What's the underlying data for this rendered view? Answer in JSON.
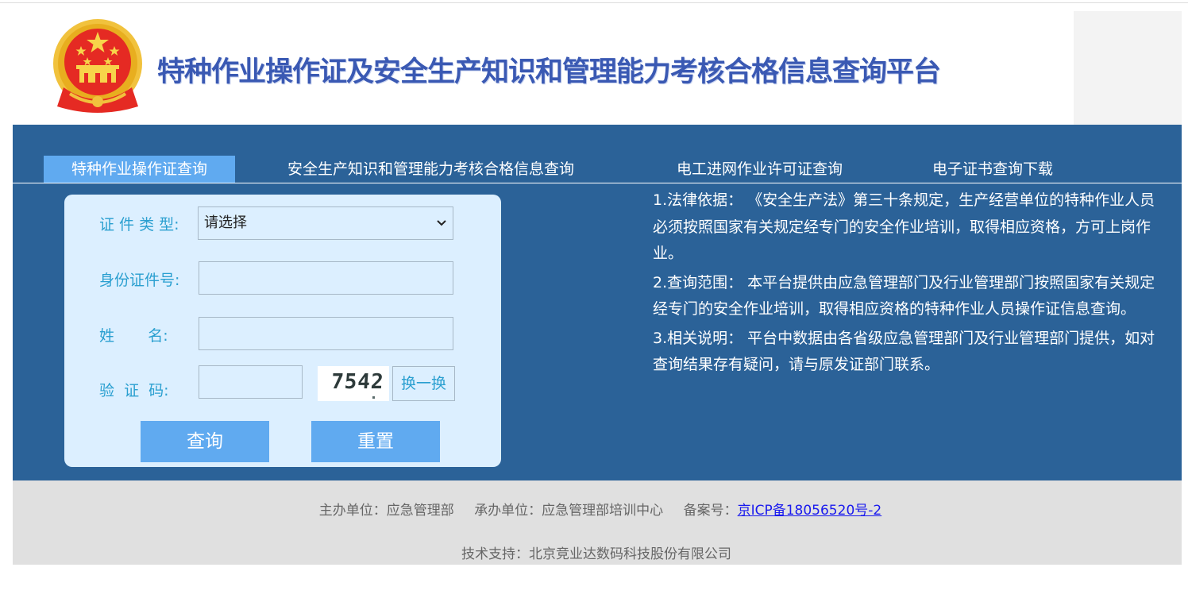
{
  "header": {
    "site_title": "特种作业操作证及安全生产知识和管理能力考核合格信息查询平台",
    "emblem_icon": "national-emblem-icon"
  },
  "tabs": [
    {
      "label": "特种作业操作证查询",
      "active": true
    },
    {
      "label": "安全生产知识和管理能力考核合格信息查询",
      "active": false
    },
    {
      "label": "电工进网作业许可证查询",
      "active": false
    },
    {
      "label": "电子证书查询下载",
      "active": false
    }
  ],
  "form": {
    "cert_type_label": "证 件 类 型:",
    "cert_type_value": "请选择",
    "id_label": "身份证件号:",
    "id_value": "",
    "name_label": "姓       名:",
    "name_value": "",
    "captcha_label": "验  证  码:",
    "captcha_value": "",
    "captcha_image_text": "7542",
    "refresh_label": "换一换",
    "query_label": "查询",
    "reset_label": "重置"
  },
  "notes": [
    "1.法律依据： 《安全生产法》第三十条规定，生产经营单位的特种作业人员必须按照国家有关规定经专门的安全作业培训，取得相应资格，方可上岗作业。",
    "2.查询范围： 本平台提供由应急管理部门及行业管理部门按照国家有关规定经专门的安全作业培训，取得相应资格的特种作业人员操作证信息查询。",
    "3.相关说明： 平台中数据由各省级应急管理部门及行业管理部门提供，如对查询结果存有疑问，请与原发证部门联系。"
  ],
  "footer": {
    "sponsor": "主办单位：应急管理部",
    "organizer": "承办单位：应急管理部培训中心",
    "icp_label": "备案号：",
    "icp_link": "京ICP备18056520号-2",
    "tech_support": "技术支持：北京竞业达数码科技股份有限公司"
  },
  "colors": {
    "main_band": "#2b6298",
    "active_tab": "#60aaf0",
    "form_panel": "#dcefff",
    "label_text": "#2a9fd0",
    "title_text": "#3a59b3",
    "footer_bg": "#e0e0e0"
  }
}
